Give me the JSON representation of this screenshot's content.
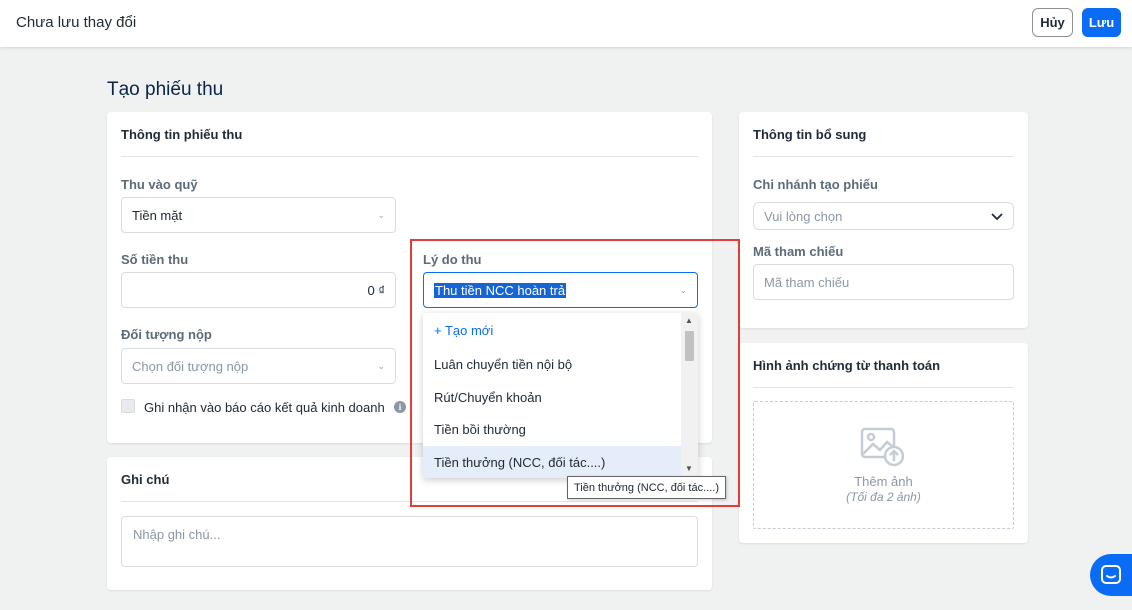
{
  "topbar": {
    "title": "Chưa lưu thay đổi",
    "cancel_label": "Hủy",
    "save_label": "Lưu"
  },
  "page": {
    "title": "Tạo phiếu thu"
  },
  "receipt_info": {
    "title": "Thông tin phiếu thu",
    "fund_label": "Thu vào quỹ",
    "fund_value": "Tiền mặt",
    "amount_label": "Số tiền thu",
    "amount_value": "0 ₫",
    "payer_label": "Đối tượng nộp",
    "payer_placeholder": "Chọn đối tượng nộp",
    "report_checkbox_label": "Ghi nhận vào báo cáo kết quả kinh doanh",
    "report_checked": false,
    "reason_label": "Lý do thu",
    "reason_value": "Thu tiền NCC hoàn trả"
  },
  "reason_dropdown": {
    "create_label": "+ Tạo mới",
    "options": [
      "Luân chuyển tiền nội bộ",
      "Rút/Chuyển khoản",
      "Tiền bồi thường",
      "Tiền thưởng (NCC, đối tác....)"
    ],
    "hovered_index": 3,
    "tooltip": "Tiền thưởng (NCC, đối tác....)"
  },
  "note": {
    "title": "Ghi chú",
    "placeholder": "Nhập ghi chú..."
  },
  "extra_info": {
    "title": "Thông tin bổ sung",
    "branch_label": "Chi nhánh tạo phiếu",
    "branch_placeholder": "Vui lòng chọn",
    "reference_label": "Mã tham chiếu",
    "reference_placeholder": "Mã tham chiếu"
  },
  "payment_images": {
    "title": "Hình ảnh chứng từ thanh toán",
    "add_label": "Thêm ảnh",
    "limit_label": "(Tối đa 2 ảnh)"
  },
  "colors": {
    "primary": "#0a6cf5",
    "highlight_frame": "#e43b3b",
    "hover_row": "#e5edfa"
  }
}
